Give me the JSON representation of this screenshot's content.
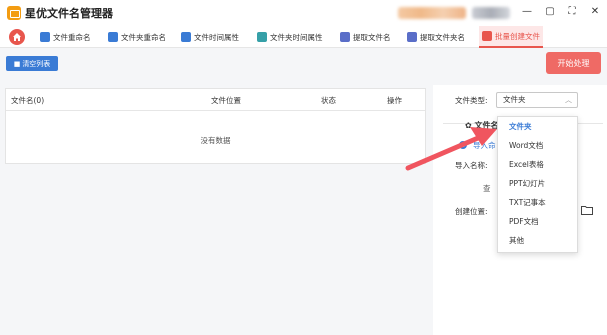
{
  "app": {
    "title": "星优文件名管理器",
    "window_controls": [
      "—",
      "▢",
      "⛶",
      "✕"
    ]
  },
  "nav": {
    "tabs": [
      {
        "label": "文件重命名",
        "icon": "rename-icon",
        "color": "#3a7bd5"
      },
      {
        "label": "文件夹重命名",
        "icon": "folder-rename-icon",
        "color": "#3a7bd5"
      },
      {
        "label": "文件时间属性",
        "icon": "file-time-icon",
        "color": "#3a7bd5"
      },
      {
        "label": "文件夹时间属性",
        "icon": "folder-time-icon",
        "color": "#36a0a8"
      },
      {
        "label": "提取文件名",
        "icon": "extract-name-icon",
        "color": "#5a6ec8"
      },
      {
        "label": "提取文件夹名",
        "icon": "extract-folder-icon",
        "color": "#5a6ec8"
      },
      {
        "label": "批量创建文件",
        "icon": "batch-create-icon",
        "color": "#e8564d",
        "active": true
      }
    ]
  },
  "toolbar": {
    "clear_label": "清空列表",
    "start_label": "开始处理"
  },
  "table": {
    "columns": [
      "文件名(0)",
      "文件位置",
      "状态",
      "操作"
    ],
    "empty_text": "没有数据"
  },
  "settings": {
    "file_type_label": "文件类型:",
    "file_type_value": "文件夹",
    "section_title": "文件名",
    "import_option": "导入命",
    "import_name_label": "导入名称:",
    "view_link": "查",
    "create_location_label": "创建位置:"
  },
  "dropdown": {
    "options": [
      "文件夹",
      "Word文档",
      "Excel表格",
      "PPT幻灯片",
      "TXT记事本",
      "PDF文档",
      "其他"
    ],
    "selected_index": 0
  },
  "colors": {
    "accent_red": "#e8564d",
    "accent_blue": "#3a7bd5",
    "start_button": "#ef6a65",
    "annotation_arrow": "#f0555f"
  }
}
